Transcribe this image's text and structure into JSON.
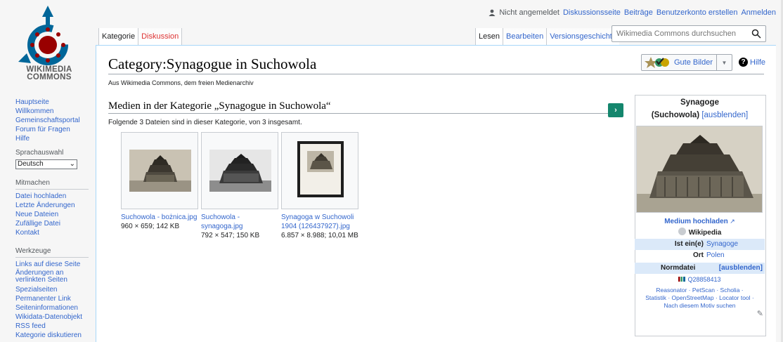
{
  "logo": {
    "text_line1": "WIKIMEDIA",
    "text_line2": "COMMONS"
  },
  "personal_tools": {
    "not_logged_in": "Nicht angemeldet",
    "talk": "Diskussionsseite",
    "contributions": "Beiträge",
    "create_account": "Benutzerkonto erstellen",
    "login": "Anmelden"
  },
  "tabs_left": {
    "category": "Kategorie",
    "discussion": "Diskussion"
  },
  "tabs_right": {
    "read": "Lesen",
    "edit": "Bearbeiten",
    "history": "Versionsgeschichte"
  },
  "search": {
    "placeholder": "Wikimedia Commons durchsuchen"
  },
  "sidebar": {
    "nav": [
      "Hauptseite",
      "Willkommen",
      "Gemeinschaftsportal",
      "Forum für Fragen",
      "Hilfe"
    ],
    "lang_heading": "Sprachauswahl",
    "lang_value": "Deutsch",
    "participate_heading": "Mitmachen",
    "participate": [
      "Datei hochladen",
      "Letzte Änderungen",
      "Neue Dateien",
      "Zufällige Datei",
      "Kontakt"
    ],
    "tools_heading": "Werkzeuge",
    "tools": [
      "Links auf diese Seite",
      "Änderungen an verlinkten Seiten",
      "Spezialseiten",
      "Permanenter Link",
      "Seiteninformationen",
      "Wikidata-Datenobjekt",
      "RSS feed",
      "Kategorie diskutieren"
    ]
  },
  "page": {
    "title": "Category:Synagogue in Suchowola",
    "tagline": "Aus Wikimedia Commons, dem freien Medienarchiv",
    "good_pictures": "Gute Bilder",
    "help": "Hilfe",
    "media_heading": "Medien in der Kategorie „Synagogue in Suchowola“",
    "media_count": "Folgende 3 Dateien sind in dieser Kategorie, von 3 insgesamt."
  },
  "gallery": [
    {
      "name": "Suchowola - bożnica.jpg",
      "meta": "960 × 659; 142 KB"
    },
    {
      "name_l1": "Suchowola -",
      "name_l2": "synagoga.jpg",
      "meta": "792 × 547; 150 KB"
    },
    {
      "name_l1": "Synagoga w Suchowoli",
      "name_l2": "1904 (126437927).jpg",
      "meta": "6.857 × 8.988; 10,01 MB"
    }
  ],
  "infobox": {
    "title_l1": "Synagoge",
    "title_l2": "(Suchowola)",
    "hide": "[ausblenden]",
    "upload": "Medium hochladen",
    "wikipedia": "Wikipedia",
    "instance_label": "Ist ein(e)",
    "instance_value": "Synagoge",
    "location_label": "Ort",
    "location_value": "Polen",
    "authority_label": "Normdatei",
    "authority_hide": "[ausblenden]",
    "qid": "Q28858413",
    "links_l1": "Reasonator · PetScan · Scholia ·",
    "links_l2": "Statistik · OpenStreetMap · Locator tool ·",
    "links_l3": "Nach diesem Motiv suchen"
  },
  "colors": {
    "link": "#3366cc",
    "accent_green": "#14866d",
    "band": "#dbe9f9"
  }
}
